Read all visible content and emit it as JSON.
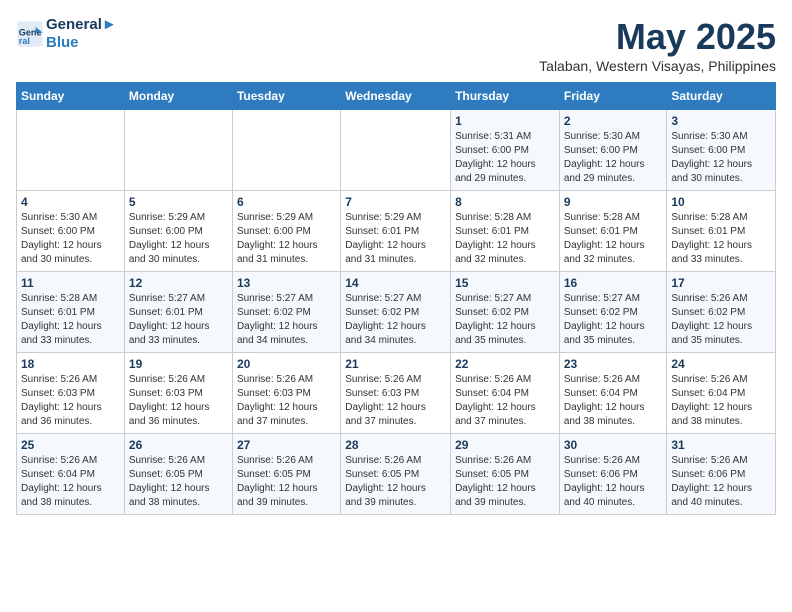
{
  "logo": {
    "line1": "General",
    "line2": "Blue"
  },
  "title": "May 2025",
  "subtitle": "Talaban, Western Visayas, Philippines",
  "weekdays": [
    "Sunday",
    "Monday",
    "Tuesday",
    "Wednesday",
    "Thursday",
    "Friday",
    "Saturday"
  ],
  "weeks": [
    [
      {
        "day": "",
        "info": ""
      },
      {
        "day": "",
        "info": ""
      },
      {
        "day": "",
        "info": ""
      },
      {
        "day": "",
        "info": ""
      },
      {
        "day": "1",
        "info": "Sunrise: 5:31 AM\nSunset: 6:00 PM\nDaylight: 12 hours\nand 29 minutes."
      },
      {
        "day": "2",
        "info": "Sunrise: 5:30 AM\nSunset: 6:00 PM\nDaylight: 12 hours\nand 29 minutes."
      },
      {
        "day": "3",
        "info": "Sunrise: 5:30 AM\nSunset: 6:00 PM\nDaylight: 12 hours\nand 30 minutes."
      }
    ],
    [
      {
        "day": "4",
        "info": "Sunrise: 5:30 AM\nSunset: 6:00 PM\nDaylight: 12 hours\nand 30 minutes."
      },
      {
        "day": "5",
        "info": "Sunrise: 5:29 AM\nSunset: 6:00 PM\nDaylight: 12 hours\nand 30 minutes."
      },
      {
        "day": "6",
        "info": "Sunrise: 5:29 AM\nSunset: 6:00 PM\nDaylight: 12 hours\nand 31 minutes."
      },
      {
        "day": "7",
        "info": "Sunrise: 5:29 AM\nSunset: 6:01 PM\nDaylight: 12 hours\nand 31 minutes."
      },
      {
        "day": "8",
        "info": "Sunrise: 5:28 AM\nSunset: 6:01 PM\nDaylight: 12 hours\nand 32 minutes."
      },
      {
        "day": "9",
        "info": "Sunrise: 5:28 AM\nSunset: 6:01 PM\nDaylight: 12 hours\nand 32 minutes."
      },
      {
        "day": "10",
        "info": "Sunrise: 5:28 AM\nSunset: 6:01 PM\nDaylight: 12 hours\nand 33 minutes."
      }
    ],
    [
      {
        "day": "11",
        "info": "Sunrise: 5:28 AM\nSunset: 6:01 PM\nDaylight: 12 hours\nand 33 minutes."
      },
      {
        "day": "12",
        "info": "Sunrise: 5:27 AM\nSunset: 6:01 PM\nDaylight: 12 hours\nand 33 minutes."
      },
      {
        "day": "13",
        "info": "Sunrise: 5:27 AM\nSunset: 6:02 PM\nDaylight: 12 hours\nand 34 minutes."
      },
      {
        "day": "14",
        "info": "Sunrise: 5:27 AM\nSunset: 6:02 PM\nDaylight: 12 hours\nand 34 minutes."
      },
      {
        "day": "15",
        "info": "Sunrise: 5:27 AM\nSunset: 6:02 PM\nDaylight: 12 hours\nand 35 minutes."
      },
      {
        "day": "16",
        "info": "Sunrise: 5:27 AM\nSunset: 6:02 PM\nDaylight: 12 hours\nand 35 minutes."
      },
      {
        "day": "17",
        "info": "Sunrise: 5:26 AM\nSunset: 6:02 PM\nDaylight: 12 hours\nand 35 minutes."
      }
    ],
    [
      {
        "day": "18",
        "info": "Sunrise: 5:26 AM\nSunset: 6:03 PM\nDaylight: 12 hours\nand 36 minutes."
      },
      {
        "day": "19",
        "info": "Sunrise: 5:26 AM\nSunset: 6:03 PM\nDaylight: 12 hours\nand 36 minutes."
      },
      {
        "day": "20",
        "info": "Sunrise: 5:26 AM\nSunset: 6:03 PM\nDaylight: 12 hours\nand 37 minutes."
      },
      {
        "day": "21",
        "info": "Sunrise: 5:26 AM\nSunset: 6:03 PM\nDaylight: 12 hours\nand 37 minutes."
      },
      {
        "day": "22",
        "info": "Sunrise: 5:26 AM\nSunset: 6:04 PM\nDaylight: 12 hours\nand 37 minutes."
      },
      {
        "day": "23",
        "info": "Sunrise: 5:26 AM\nSunset: 6:04 PM\nDaylight: 12 hours\nand 38 minutes."
      },
      {
        "day": "24",
        "info": "Sunrise: 5:26 AM\nSunset: 6:04 PM\nDaylight: 12 hours\nand 38 minutes."
      }
    ],
    [
      {
        "day": "25",
        "info": "Sunrise: 5:26 AM\nSunset: 6:04 PM\nDaylight: 12 hours\nand 38 minutes."
      },
      {
        "day": "26",
        "info": "Sunrise: 5:26 AM\nSunset: 6:05 PM\nDaylight: 12 hours\nand 38 minutes."
      },
      {
        "day": "27",
        "info": "Sunrise: 5:26 AM\nSunset: 6:05 PM\nDaylight: 12 hours\nand 39 minutes."
      },
      {
        "day": "28",
        "info": "Sunrise: 5:26 AM\nSunset: 6:05 PM\nDaylight: 12 hours\nand 39 minutes."
      },
      {
        "day": "29",
        "info": "Sunrise: 5:26 AM\nSunset: 6:05 PM\nDaylight: 12 hours\nand 39 minutes."
      },
      {
        "day": "30",
        "info": "Sunrise: 5:26 AM\nSunset: 6:06 PM\nDaylight: 12 hours\nand 40 minutes."
      },
      {
        "day": "31",
        "info": "Sunrise: 5:26 AM\nSunset: 6:06 PM\nDaylight: 12 hours\nand 40 minutes."
      }
    ]
  ]
}
